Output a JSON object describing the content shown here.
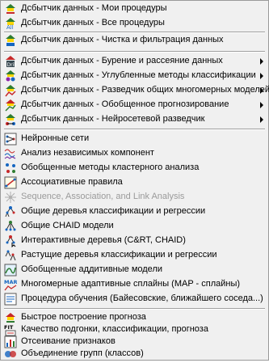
{
  "menu": {
    "items": [
      {
        "label": "Дсбытчик данных - Мои процедуры",
        "icon": "data-miner-hat-icon"
      },
      {
        "label": "Дсбытчик данных - Все процедуры",
        "icon": "data-miner-all-icon"
      },
      {
        "label": "Дсбытчик данных - Чистка и фильтрация данных",
        "icon": "data-cleaning-icon"
      },
      {
        "label": "Дсбытчик данных - Бурение и рассеяние данных",
        "icon": "drill-down-icon"
      },
      {
        "label": "Дсбытчик данных - Углубленные методы классификации",
        "icon": "classification-icon"
      },
      {
        "label": "Дсбытчик данных - Разведчик общих многомерных моделей",
        "icon": "multivariate-models-icon"
      },
      {
        "label": "Дсбытчик данных - Обобщенное прогнозирование",
        "icon": "forecasting-icon"
      },
      {
        "label": "Дсбытчик данных - Нейросетевой разведчик",
        "icon": "neural-explorer-icon"
      },
      {
        "label": "Нейронные сети",
        "icon": "neural-networks-icon"
      },
      {
        "label": "Анализ независимых компонент",
        "icon": "ica-icon"
      },
      {
        "label": "Обобщенные методы кластерного анализа",
        "icon": "cluster-icon"
      },
      {
        "label": "Ассоциативные правила",
        "icon": "association-rules-icon"
      },
      {
        "label": "Sequence, Association, and Link Analysis",
        "icon": "link-analysis-icon"
      },
      {
        "label": "Общие деревья классификации и регрессии",
        "icon": "tree-icon"
      },
      {
        "label": "Общие CHAID модели",
        "icon": "chaid-icon"
      },
      {
        "label": "Интерактивные деревья (C&RT, CHAID)",
        "icon": "interactive-tree-icon"
      },
      {
        "label": "Растущие деревья классификации и регрессии",
        "icon": "boosted-tree-icon"
      },
      {
        "label": "Обобщенные аддитивные модели",
        "icon": "additive-models-icon"
      },
      {
        "label": "Многомерные адаптивные сплайны (MAP - сплайны)",
        "icon": "mars-icon"
      },
      {
        "label": "Процедура обучения (Байесовские, ближайшего соседа...)",
        "icon": "learning-procedure-icon"
      },
      {
        "label": "Быстрое построение прогноза",
        "icon": "rapid-forecast-icon"
      },
      {
        "label": "Качество подгонки, классификации, прогноза",
        "icon": "goodness-of-fit-icon"
      },
      {
        "label": "Отсеивание признаков",
        "icon": "feature-selection-icon"
      },
      {
        "label": "Объединение групп (классов)",
        "icon": "combine-groups-icon"
      }
    ]
  }
}
